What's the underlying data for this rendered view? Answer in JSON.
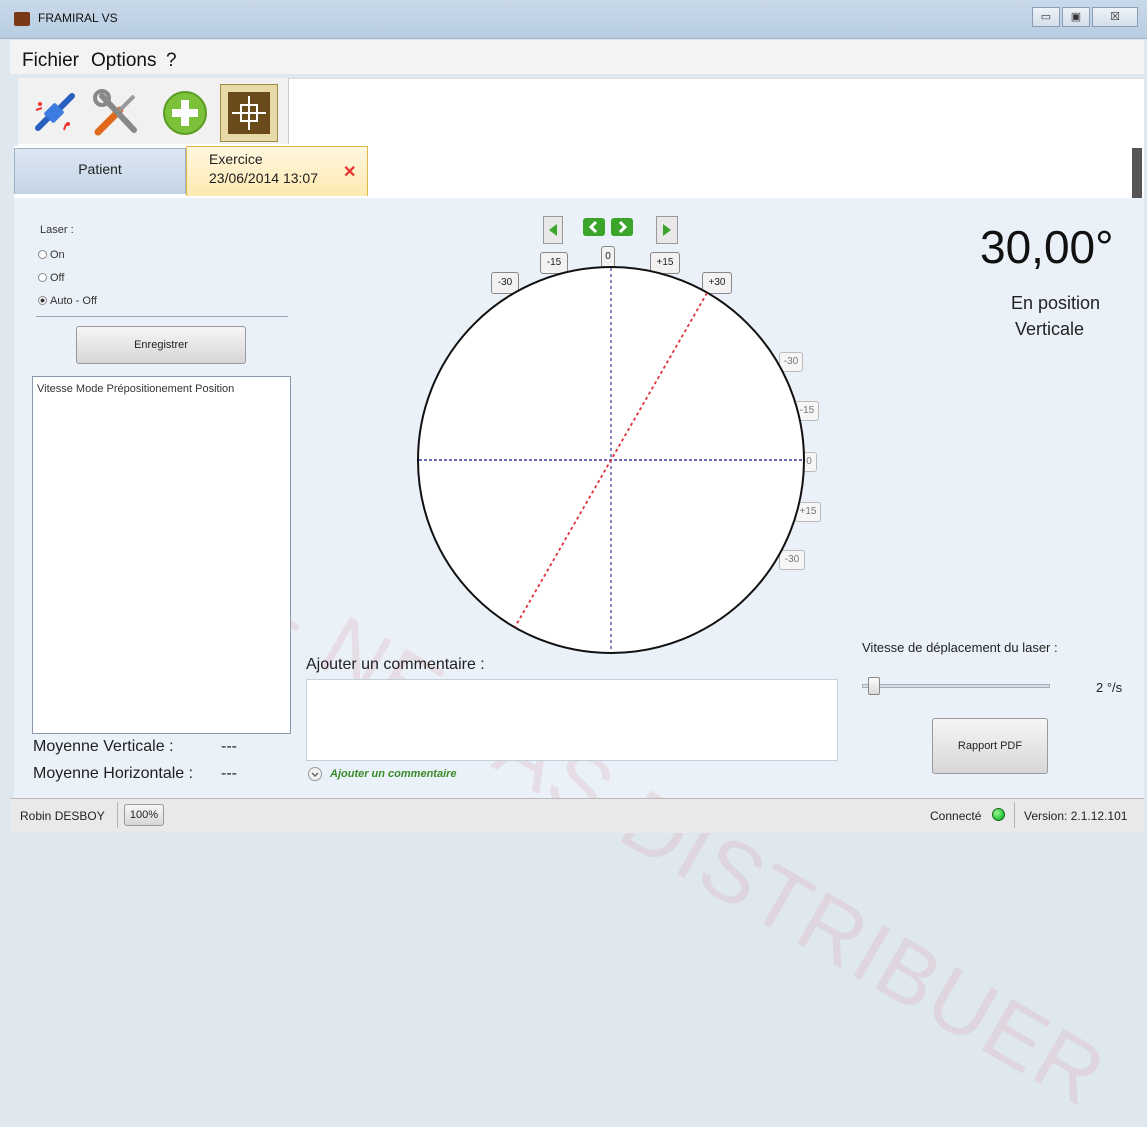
{
  "window": {
    "title": "FRAMIRAL VS",
    "minimize": "▭",
    "maximize": "▣",
    "close": "☒"
  },
  "menu": [
    "Fichier",
    "Options",
    "?"
  ],
  "toolbar": {
    "icons": [
      "connect-icon",
      "tools-icon",
      "add-icon",
      "crosshair-icon"
    ]
  },
  "tabs": {
    "patient": "Patient",
    "exercice_title": "Exercice",
    "exercice_date": "23/06/2014 13:07",
    "close": "✕"
  },
  "laser": {
    "label": "Laser :",
    "options": [
      "On",
      "Off",
      "Auto - Off"
    ],
    "selected": "Auto - Off"
  },
  "record_button": "Enregistrer",
  "list": {
    "header": "Vitesse Mode Prépositionement Position"
  },
  "averages": {
    "vertical_label": "Moyenne Verticale :",
    "vertical_value": "---",
    "horizontal_label": "Moyenne Horizontale :",
    "horizontal_value": "---"
  },
  "scale_top": {
    "minus30": "-30",
    "minus15": "-15",
    "zero": "0",
    "plus15": "+15",
    "plus30": "+30"
  },
  "scale_right": {
    "minus30": "-30",
    "minus15": "-15",
    "zero": "0",
    "plus15": "+15",
    "plus30b": "-30"
  },
  "angle": {
    "value": "30,00°",
    "status_line1": "En position",
    "status_line2": "Verticale"
  },
  "speed": {
    "label": "Vitesse de déplacement du laser :",
    "value": "2 °/s",
    "level": 0
  },
  "comment": {
    "title": "Ajouter un commentaire :",
    "link": "Ajouter un commentaire",
    "value": ""
  },
  "report_button": "Rapport PDF",
  "watermark": "BETA - NE PAS DISTRIBUER",
  "status": {
    "user": "Robin DESBOY",
    "zoom": "100%",
    "connection": "Connecté",
    "version": "Version: 2.1.12.101"
  },
  "colors": {
    "accent": "#f0b429",
    "laser_line": "#e0303a",
    "axis_line": "#3a3aa0",
    "connected": "#2ecc40",
    "link": "#3a8a2a"
  }
}
